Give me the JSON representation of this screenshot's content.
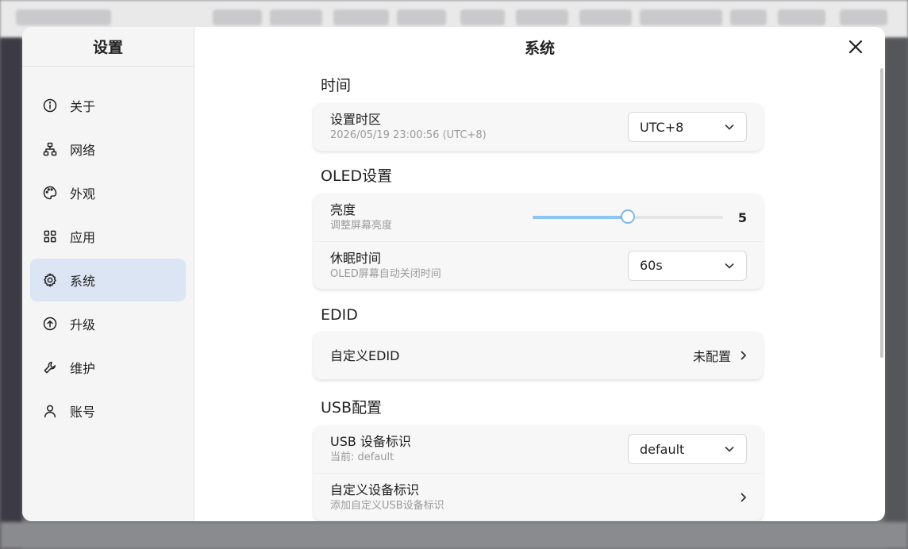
{
  "sidebar": {
    "title": "设置",
    "items": [
      {
        "label": "关于",
        "icon": "info-icon"
      },
      {
        "label": "网络",
        "icon": "network-icon"
      },
      {
        "label": "外观",
        "icon": "palette-icon"
      },
      {
        "label": "应用",
        "icon": "apps-grid-icon"
      },
      {
        "label": "系统",
        "icon": "gear-icon",
        "active": true
      },
      {
        "label": "升级",
        "icon": "upgrade-arrow-icon"
      },
      {
        "label": "维护",
        "icon": "wrench-icon"
      },
      {
        "label": "账号",
        "icon": "user-icon"
      }
    ]
  },
  "header": {
    "title": "系统"
  },
  "sections": {
    "time": {
      "title": "时间",
      "timezone_label": "设置时区",
      "timezone_sub": "2026/05/19 23:00:56 (UTC+8)",
      "timezone_value": "UTC+8"
    },
    "oled": {
      "title": "OLED设置",
      "brightness_label": "亮度",
      "brightness_sub": "调整屏幕亮度",
      "brightness_value": "5",
      "brightness_fraction": 0.5,
      "sleep_label": "休眠时间",
      "sleep_sub": "OLED屏幕自动关闭时间",
      "sleep_value": "60s"
    },
    "edid": {
      "title": "EDID",
      "custom_label": "自定义EDID",
      "custom_value": "未配置"
    },
    "usb": {
      "title": "USB配置",
      "device_id_label": "USB 设备标识",
      "device_id_sub": "当前: default",
      "device_id_value": "default",
      "custom_id_label": "自定义设备标识",
      "custom_id_sub": "添加自定义USB设备标识"
    }
  },
  "colors": {
    "active_nav": "#dbe5f3",
    "slider_accent": "#8cc4f3"
  }
}
